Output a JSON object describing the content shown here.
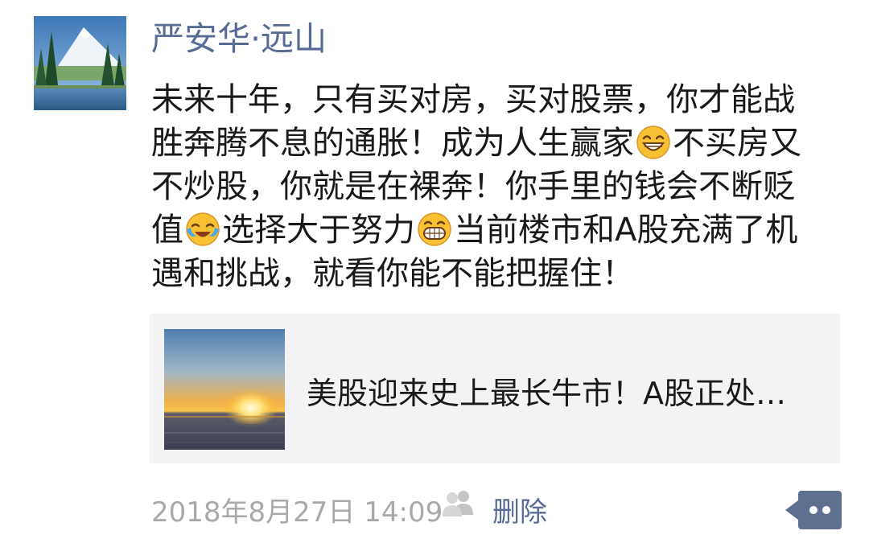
{
  "post": {
    "author": "严安华·远山",
    "text_lines": [
      [
        "未来十年，只有买对房，买对股票，你才能战"
      ],
      [
        "胜奔腾不息的通胀！成为人生赢家",
        "不买房又"
      ],
      [
        "不炒股，你就是在裸奔！你手里的钱会不断贬"
      ],
      [
        "值",
        "选择大于努力",
        "当前楼市和A股充满了机"
      ],
      [
        "遇和挑战，就看你能不能把握住！"
      ]
    ],
    "emojis": [
      "grin-emoji",
      "crying-laughing-emoji",
      "big-grin-emoji"
    ],
    "link": {
      "title": "美股迎来史上最长牛市！A股正处…"
    },
    "timestamp": "2018年8月27日 14:09",
    "delete_label": "删除"
  },
  "colors": {
    "name_blue": "#576b95",
    "text": "#191919",
    "meta_gray": "#a9a9a9",
    "card_bg": "#f3f3f5",
    "more_button": "#5e6f90"
  },
  "icons": {
    "visibility": "friends-visibility-icon",
    "more": "more-options-icon"
  }
}
